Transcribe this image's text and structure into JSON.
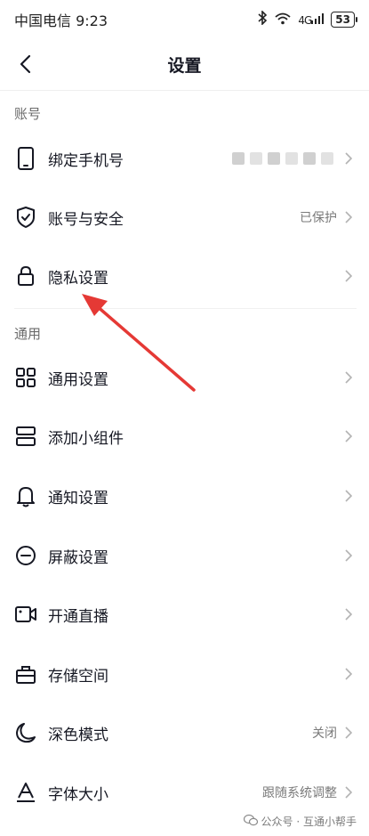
{
  "status": {
    "carrier_time": "中国电信 9:23",
    "signal": "4G",
    "battery": "53"
  },
  "nav": {
    "title": "设置"
  },
  "sections": {
    "account": "账号",
    "general": "通用"
  },
  "rows": {
    "bind_phone": {
      "label": "绑定手机号",
      "value": ""
    },
    "account_security": {
      "label": "账号与安全",
      "value": "已保护"
    },
    "privacy": {
      "label": "隐私设置",
      "value": ""
    },
    "general_settings": {
      "label": "通用设置",
      "value": ""
    },
    "add_widget": {
      "label": "添加小组件",
      "value": ""
    },
    "notifications": {
      "label": "通知设置",
      "value": ""
    },
    "block": {
      "label": "屏蔽设置",
      "value": ""
    },
    "live": {
      "label": "开通直播",
      "value": ""
    },
    "storage": {
      "label": "存储空间",
      "value": ""
    },
    "dark_mode": {
      "label": "深色模式",
      "value": "关闭"
    },
    "font_size": {
      "label": "字体大小",
      "value": "跟随系统调整"
    }
  },
  "watermark": {
    "text": "公众号 · 互通小帮手"
  },
  "colors": {
    "annotation_arrow": "#e53935"
  }
}
